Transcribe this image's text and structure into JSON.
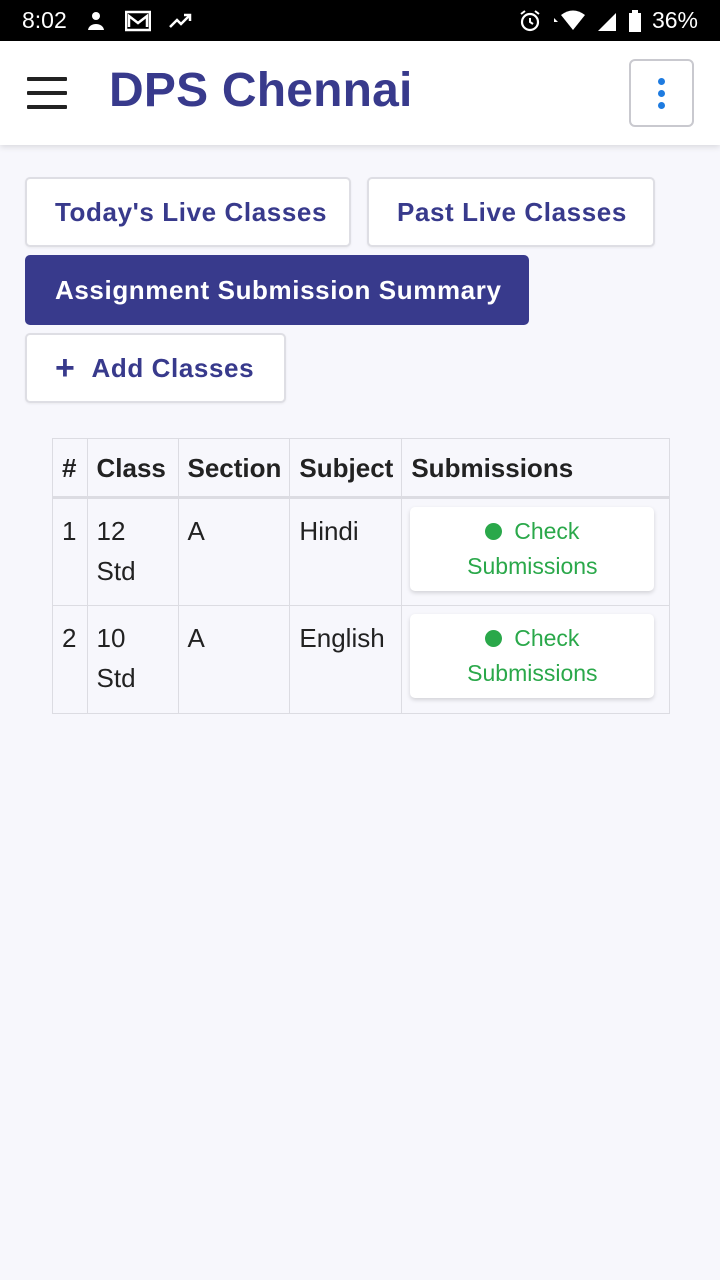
{
  "status_bar": {
    "time": "8:02",
    "battery": "36%"
  },
  "app_bar": {
    "title": "DPS Chennai"
  },
  "nav_buttons": {
    "today": "Today's Live Classes",
    "past": "Past Live Classes",
    "summary": "Assignment Submission Summary",
    "add": "Add Classes",
    "add_icon": "+"
  },
  "table": {
    "headers": [
      "#",
      "Class",
      "Section",
      "Subject",
      "Submissions"
    ],
    "rows": [
      {
        "num": "1",
        "class_line1": "12",
        "class_line2": "Std",
        "section": "A",
        "subject": "Hindi",
        "action_line1": "Check",
        "action_line2": "Submissions"
      },
      {
        "num": "2",
        "class_line1": "10",
        "class_line2": "Std",
        "section": "A",
        "subject": "English",
        "action_line1": "Check",
        "action_line2": "Submissions"
      }
    ]
  },
  "colors": {
    "brand": "#383a8c",
    "accent_green": "#2aa84a",
    "kebab_dots": "#1e7be0"
  },
  "icons": {
    "menu": "hamburger-menu-icon",
    "more": "more-vertical-icon",
    "status_dot": "green-dot-icon"
  }
}
